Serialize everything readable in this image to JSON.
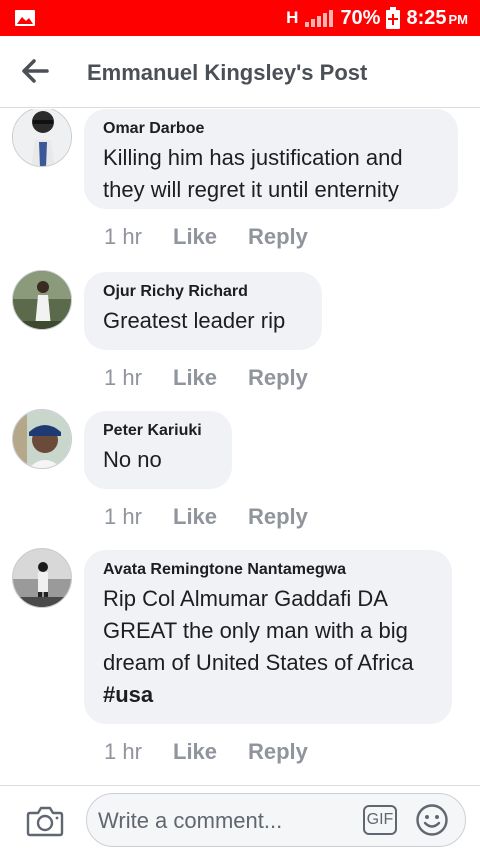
{
  "status_bar": {
    "network": "H",
    "battery": "70%",
    "time": "8:25",
    "ampm": "PM"
  },
  "header": {
    "title": "Emmanuel Kingsley's Post"
  },
  "comments": [
    {
      "name": "Omar Darboe",
      "text": "Killing him has justification and they will regret it until enternity",
      "time": "1 hr",
      "like": "Like",
      "reply": "Reply"
    },
    {
      "name": "Ojur Richy Richard",
      "text": "Greatest leader rip",
      "time": "1 hr",
      "like": "Like",
      "reply": "Reply"
    },
    {
      "name": "Peter Kariuki",
      "text": "No no",
      "time": "1 hr",
      "like": "Like",
      "reply": "Reply"
    },
    {
      "name": "Avata Remingtone Nantamegwa",
      "text": "Rip Col Almumar Gaddafi DA GREAT the only man with a big dream of United States of Africa ",
      "hashtag": "#usa",
      "time": "1 hr",
      "like": "Like",
      "reply": "Reply"
    }
  ],
  "composer": {
    "placeholder": "Write a comment...",
    "gif_label": "GIF"
  },
  "colors": {
    "status_bar": "#ff0000",
    "bubble": "#f0f2f5",
    "muted_text": "#90949c"
  },
  "icons": [
    "image-icon",
    "signal-icon",
    "battery-icon",
    "back-arrow-icon",
    "camera-icon",
    "gif-icon",
    "emoji-icon"
  ]
}
